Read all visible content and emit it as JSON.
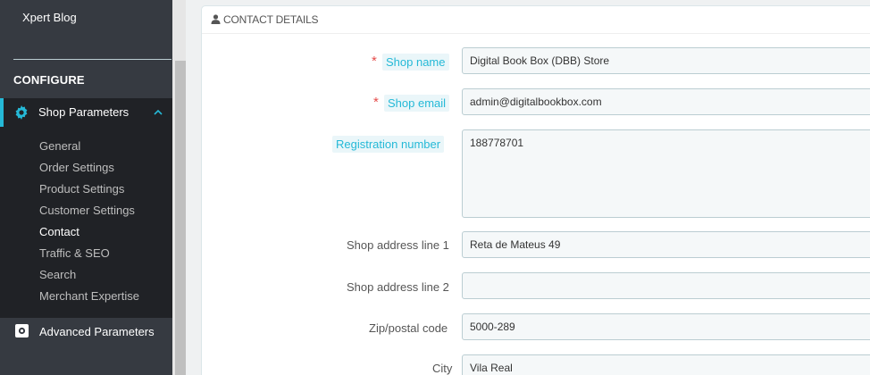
{
  "sidebar": {
    "blog_link": "Xpert Blog",
    "section_title": "CONFIGURE",
    "active_menu": "Shop Parameters",
    "submenu": [
      "General",
      "Order Settings",
      "Product Settings",
      "Customer Settings",
      "Contact",
      "Traffic & SEO",
      "Search",
      "Merchant Expertise"
    ],
    "current_submenu": "Contact",
    "next_menu": "Advanced Parameters"
  },
  "panel": {
    "title": "CONTACT DETAILS",
    "fields": {
      "shop_name": {
        "label": "Shop name",
        "value": "Digital Book Box (DBB) Store",
        "required": true
      },
      "shop_email": {
        "label": "Shop email",
        "value": "admin@digitalbookbox.com",
        "required": true
      },
      "registration_number": {
        "label": "Registration number",
        "value": "188778701"
      },
      "address_line_1": {
        "label": "Shop address line 1",
        "value": "Reta de Mateus 49"
      },
      "address_line_2": {
        "label": "Shop address line 2",
        "value": ""
      },
      "zip_code": {
        "label": "Zip/postal code",
        "value": "5000-289"
      },
      "city": {
        "label": "City",
        "value": "Vila Real"
      }
    },
    "required_mark": "*"
  },
  "colors": {
    "accent": "#25b9d7",
    "sidebar_bg": "#363a41",
    "required": "#e54c4b"
  }
}
